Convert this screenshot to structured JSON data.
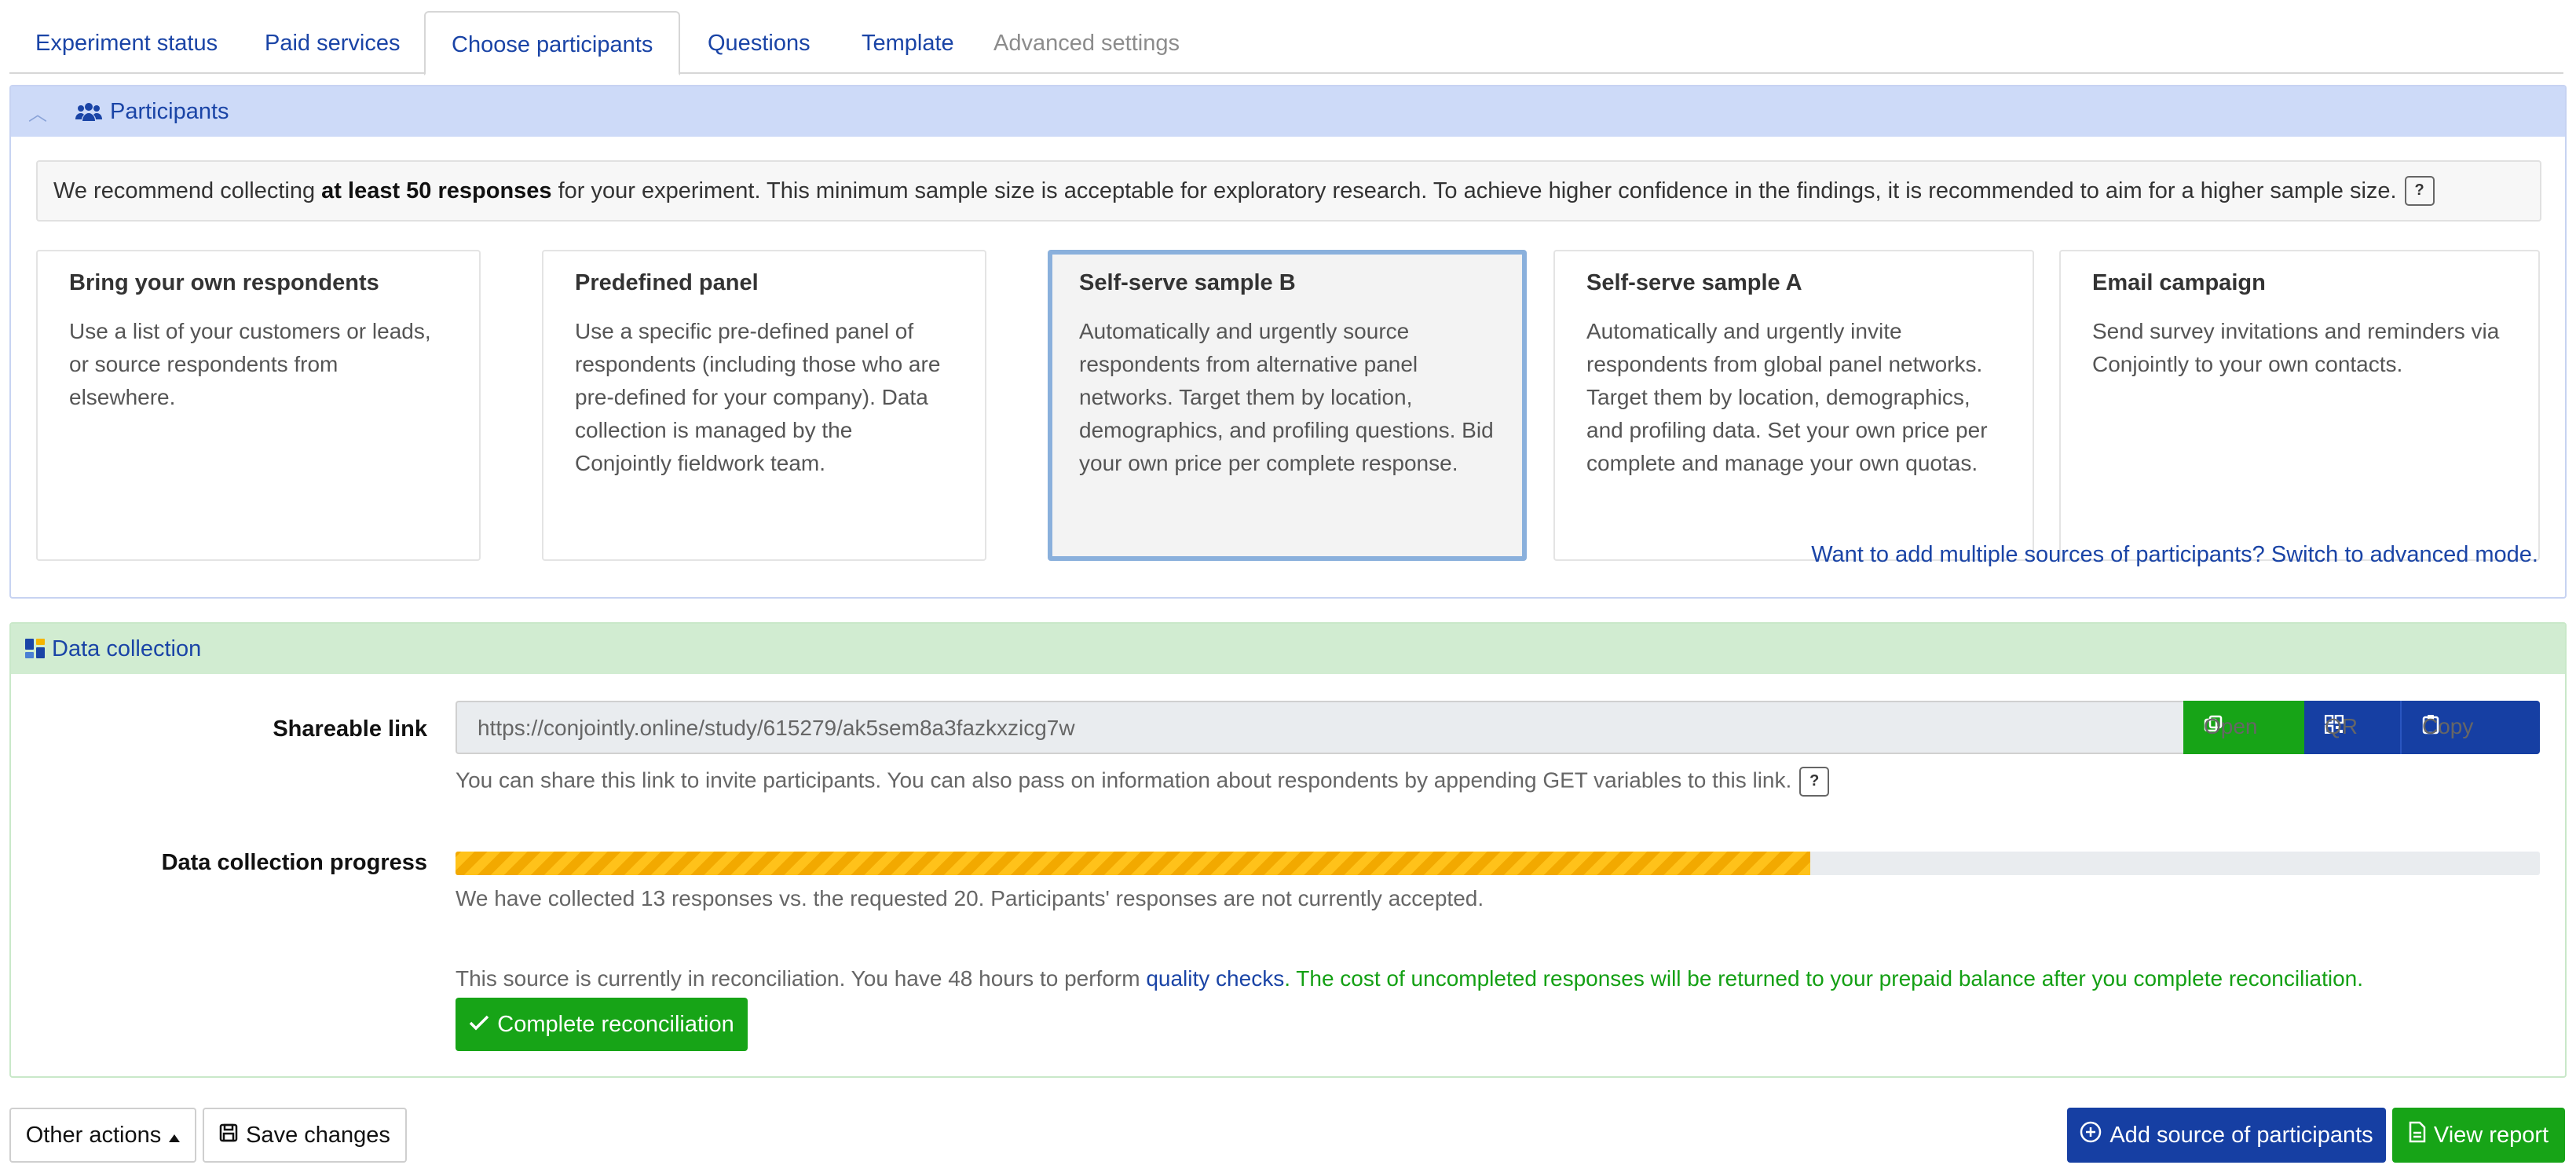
{
  "tabs": [
    {
      "label": "Experiment status"
    },
    {
      "label": "Paid services"
    },
    {
      "label": "Choose participants"
    },
    {
      "label": "Questions"
    },
    {
      "label": "Template"
    },
    {
      "label": "Advanced settings"
    }
  ],
  "participants": {
    "title": "Participants",
    "notice_before": "We recommend collecting ",
    "notice_bold": "at least 50 responses",
    "notice_after": " for your experiment. This minimum sample size is acceptable for exploratory research. To achieve higher confidence in the findings, it is recommended to aim for a higher sample size.",
    "help_icon": "?",
    "options": [
      {
        "title": "Bring your own respondents",
        "text": "Use a list of your customers or leads, or source respondents from elsewhere."
      },
      {
        "title": "Predefined panel",
        "text": "Use a specific pre-defined panel of respondents (including those who are pre-defined for your company). Data collection is managed by the Conjointly fieldwork team."
      },
      {
        "title": "Self-serve sample B",
        "text": "Automatically and urgently source respondents from alternative panel networks. Target them by location, demographics, and profiling questions. Bid your own price per complete response."
      },
      {
        "title": "Self-serve sample A",
        "text": "Automatically and urgently invite respondents from global panel networks. Target them by location, demographics, and profiling data. Set your own price per complete and manage your own quotas."
      },
      {
        "title": "Email campaign",
        "text": "Send survey invitations and reminders via Conjointly to your own contacts."
      }
    ],
    "advanced_link": "Want to add multiple sources of participants? Switch to advanced mode."
  },
  "data_collection": {
    "title": "Data collection",
    "shareable_label": "Shareable link",
    "shareable_url": "https://conjointly.online/study/615279/ak5sem8a3fazkxzicg7w",
    "open_label": "Open",
    "qr_label": "QR",
    "copy_label": "Copy",
    "share_help": "You can share this link to invite participants. You can also pass on information about respondents by appending GET variables to this link.",
    "progress_label": "Data collection progress",
    "progress_fraction": 0.65,
    "progress_text": "We have collected 13 responses vs. the requested 20. Participants' responses are not currently accepted.",
    "recon_before": "This source is currently in reconciliation. You have 48 hours to perform ",
    "recon_link": "quality checks",
    "recon_after": ". The cost of uncompleted responses will be returned to your prepaid balance after you complete reconciliation.",
    "complete_label": "Complete reconciliation"
  },
  "footer": {
    "other_actions": "Other actions",
    "save_changes": "Save changes",
    "add_source": "Add source of participants",
    "view_report": "View report"
  },
  "colors": {
    "link_blue": "#1a44a6",
    "success_green": "#17a417",
    "primary_blue": "#163fa3",
    "progress_yellow": "#ffc21a"
  }
}
